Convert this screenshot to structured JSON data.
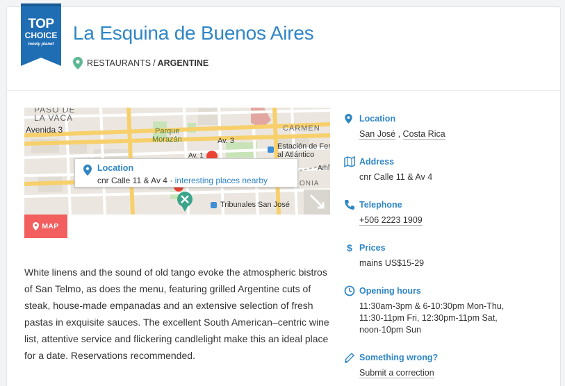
{
  "badge": {
    "top": "TOP",
    "choice": "CHOICE",
    "brand": "lonely planet"
  },
  "title": "La Esquina de Buenos Aires",
  "categories": {
    "first": "RESTAURANTS",
    "separator": "/",
    "second": "ARGENTINE"
  },
  "map": {
    "labels": {
      "paso": "PASO DE",
      "vaca": "LA VACA",
      "avenida3": "Avenida 3",
      "parque": "Parque",
      "morazan": "Morazán",
      "av3": "Av. 3",
      "carmen": "CARMEN",
      "estacion1": "Estación de Fer",
      "estacion2": "al Atlántico",
      "av1": "Av. 1",
      "aml": "Aml",
      "tribunales": "Tribunales San José",
      "colonia": "ONIA"
    },
    "popup": {
      "title": "Location",
      "address": "cnr Calle 11 & Av 4",
      "dot": " · ",
      "link": "interesting places nearby"
    },
    "button_label": "MAP"
  },
  "description": "White linens and the sound of old tango evoke the atmospheric bistros of San Telmo, as does the menu, featuring grilled Argentine cuts of steak, house-made empanadas and an extensive selection of fresh pastas in exquisite sauces. The excellent South American–centric wine list, attentive service and flickering candlelight make this an ideal place for a date. Reservations recommended.",
  "sidebar": {
    "location": {
      "label": "Location",
      "city": "San José",
      "comma": " , ",
      "country": "Costa Rica"
    },
    "address": {
      "label": "Address",
      "value": "cnr Calle 11 & Av 4"
    },
    "telephone": {
      "label": "Telephone",
      "value": "+506 2223 1909"
    },
    "prices": {
      "label": "Prices",
      "icon": "$",
      "value": "mains US$15-29"
    },
    "hours": {
      "label": "Opening hours",
      "line1": "11:30am-3pm & 6-10:30pm Mon-Thu,",
      "line2": "11:30-11pm Fri, 12:30pm-11pm Sat,",
      "line3": "noon-10pm Sun"
    },
    "wrong": {
      "label": "Something wrong?",
      "link": "Submit a correction"
    }
  },
  "colors": {
    "accent": "#2f86c5",
    "map_button": "#f35e5e",
    "badge": "#1f6db3"
  }
}
